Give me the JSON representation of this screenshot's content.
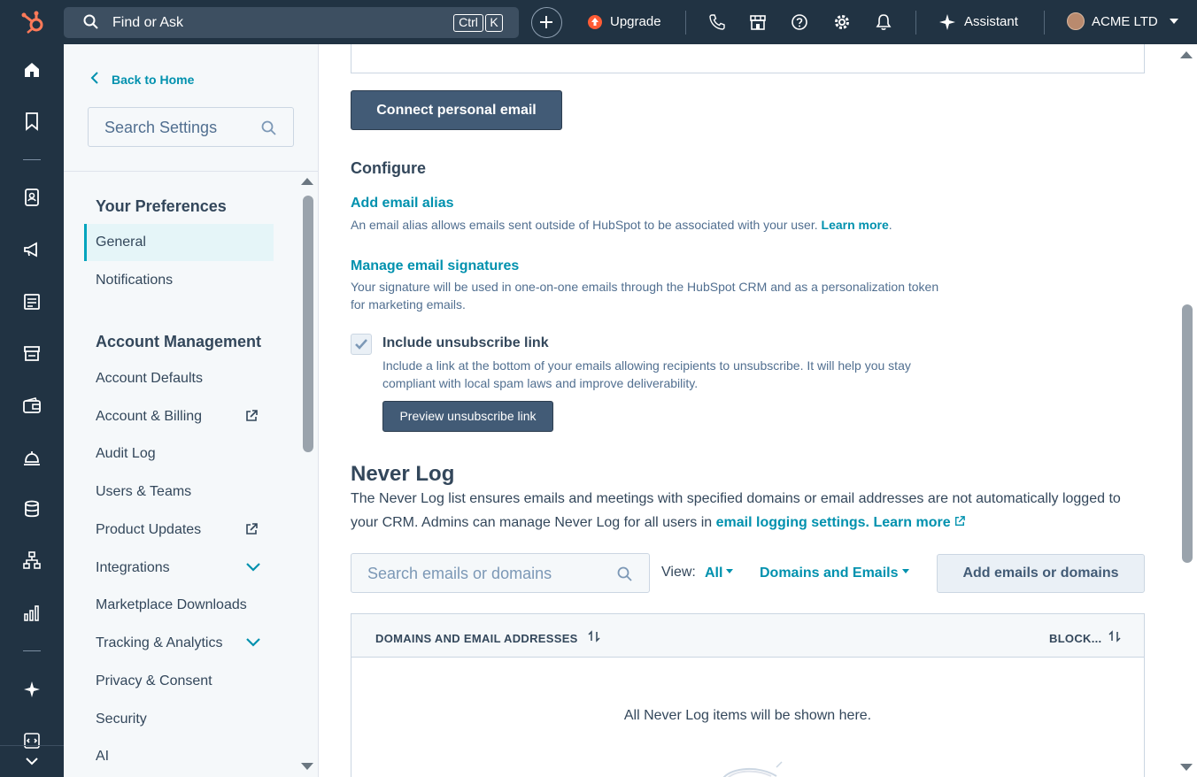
{
  "topbar": {
    "search_text": "Find or Ask",
    "kbd_ctrl": "Ctrl",
    "kbd_k": "K",
    "upgrade_label": "Upgrade",
    "assistant_label": "Assistant",
    "account_name": "ACME LTD"
  },
  "sidebar": {
    "back_label": "Back to Home",
    "search_placeholder": "Search Settings",
    "your_preferences_title": "Your Preferences",
    "preferences_items": [
      "General",
      "Notifications"
    ],
    "account_management_title": "Account Management",
    "account_items": [
      "Account Defaults",
      "Account & Billing",
      "Audit Log",
      "Users & Teams",
      "Product Updates",
      "Integrations",
      "Marketplace Downloads",
      "Tracking & Analytics",
      "Privacy & Consent",
      "Security",
      "AI"
    ]
  },
  "main": {
    "connect_button": "Connect personal email",
    "configure_title": "Configure",
    "alias_title": "Add email alias",
    "alias_desc": "An email alias allows emails sent outside of HubSpot to be associated with your user.",
    "alias_learn_more": "Learn more",
    "signatures_title": "Manage email signatures",
    "signatures_desc": "Your signature will be used in one-on-one emails through the HubSpot CRM and as a personalization token for marketing emails.",
    "unsubscribe_label": "Include unsubscribe link",
    "unsubscribe_desc": "Include a link at the bottom of your emails allowing recipients to unsubscribe. It will help you stay compliant with local spam laws and improve deliverability.",
    "preview_button": "Preview unsubscribe link",
    "never_log_title": "Never Log",
    "never_log_desc": "The Never Log list ensures emails and meetings with specified domains or email addresses are not automatically logged to your CRM. Admins can manage Never Log for all users in",
    "never_log_link1": "email logging settings.",
    "never_log_link2": "Learn more",
    "search_placeholder": "Search emails or domains",
    "view_label": "View:",
    "view_value": "All",
    "type_filter": "Domains and Emails",
    "add_button": "Add emails or domains",
    "table_col1": "DOMAINS AND EMAIL ADDRESSES",
    "table_col2": "BLOCK...",
    "empty_text": "All Never Log items will be shown here."
  },
  "colors": {
    "nav_bg": "#213343",
    "accent": "#0091ae",
    "active_bg": "#e5f5f8",
    "button_dark": "#425b76"
  }
}
